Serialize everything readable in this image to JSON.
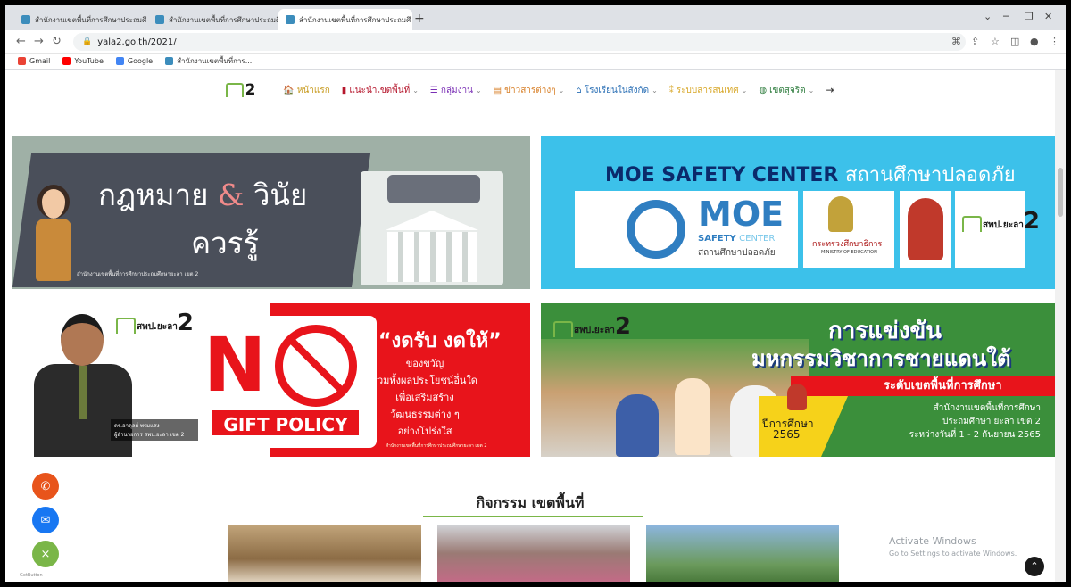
{
  "browser": {
    "tabs": [
      {
        "label": "สำนักงานเขตพื้นที่การศึกษาประถมศึ",
        "close": "×"
      },
      {
        "label": "สำนักงานเขตพื้นที่การศึกษาประถมศึ",
        "close": "×"
      },
      {
        "label": "สำนักงานเขตพื้นที่การศึกษาประถมศึ",
        "close": "×"
      }
    ],
    "new_tab": "+",
    "url": "yala2.go.th/2021/",
    "bookmarks": [
      "Gmail",
      "YouTube",
      "Google",
      "สำนักงานเขตพื้นที่การ..."
    ]
  },
  "site": {
    "logo_number": "2",
    "nav": [
      {
        "icon": "home-icon",
        "label": "หน้าแรก",
        "color": "#c79a1e",
        "caret": false
      },
      {
        "icon": "book-icon",
        "label": "แนะนำเขตพื้นที่",
        "color": "#b5162c",
        "caret": true
      },
      {
        "icon": "list-icon",
        "label": "กลุ่มงาน",
        "color": "#7a2fb5",
        "caret": true
      },
      {
        "icon": "newspaper-icon",
        "label": "ข่าวสารต่างๆ",
        "color": "#d8812a",
        "caret": true
      },
      {
        "icon": "school-icon",
        "label": "โรงเรียนในสังกัด",
        "color": "#2a6fb5",
        "caret": true
      },
      {
        "icon": "network-icon",
        "label": "ระบบสารสนเทศ",
        "color": "#d8a82a",
        "caret": true
      },
      {
        "icon": "globe-icon",
        "label": "เขตสุจริต",
        "color": "#2a7a3a",
        "caret": true
      },
      {
        "icon": "login-icon",
        "label": "",
        "color": "#333333",
        "caret": false
      }
    ]
  },
  "banners": {
    "law": {
      "line1": "กฎหมาย",
      "amp": "&",
      "line1b": "วินัย",
      "line2": "ควรรู้",
      "footer": "สำนักงานเขตพื้นที่การศึกษาประถมศึกษายะลา เขต 2"
    },
    "moe": {
      "title_en": "MOE SAFETY CENTER",
      "title_th": "สถานศึกษาปลอดภัย",
      "logo_big": "MOE",
      "logo_safety": "SAFETY",
      "logo_center": "CENTER",
      "logo_th": "สถานศึกษาปลอดภัย",
      "ministry_th": "กระทรวงศึกษาธิการ",
      "ministry_en": "MINISTRY OF EDUCATION",
      "logo_label": "สพป.ยะลา",
      "logo_number": "2"
    },
    "nogift": {
      "big_letter": "N",
      "policy": "GIFT POLICY",
      "slogan": "“งดรับ งดให้”",
      "lines": [
        "ของขวัญ",
        "รวมทั้งผลประโยชน์อื่นใด",
        "เพื่อเสริมสร้าง",
        "วัฒนธรรมต่าง ๆ",
        "อย่างโปร่งใส"
      ],
      "name": "ดร.อาดุลย์ พรมแสง",
      "position": "ผู้อำนวยการ สพป.ยะลา เขต 2",
      "footer": "สำนักงานเขตพื้นที่การศึกษาประถมศึกษายะลา เขต 2",
      "logo_label": "สพป.ยะลา",
      "logo_number": "2"
    },
    "contest": {
      "title1": "การแข่งขัน",
      "title2": "มหกรรมวิชาการชายแดนใต้",
      "level": "ระดับเขตพื้นที่การศึกษา",
      "year_label": "ปีการศึกษา",
      "year": "2565",
      "info": [
        "สำนักงานเขตพื้นที่การศึกษา",
        "ประถมศึกษา ยะลา เขต 2",
        "ระหว่างวันที่ 1 - 2 กันยายน 2565"
      ],
      "logo_label": "สพป.ยะลา",
      "logo_number": "2"
    }
  },
  "section": {
    "title": "กิจกรรม เขตพื้นที่"
  },
  "os": {
    "activate_title": "Activate Windows",
    "activate_sub": "Go to Settings to activate Windows."
  },
  "floating": {
    "getbutton_label": "GetButton",
    "colors": [
      "#e8541b",
      "#1877f2",
      "#7ab648"
    ]
  }
}
